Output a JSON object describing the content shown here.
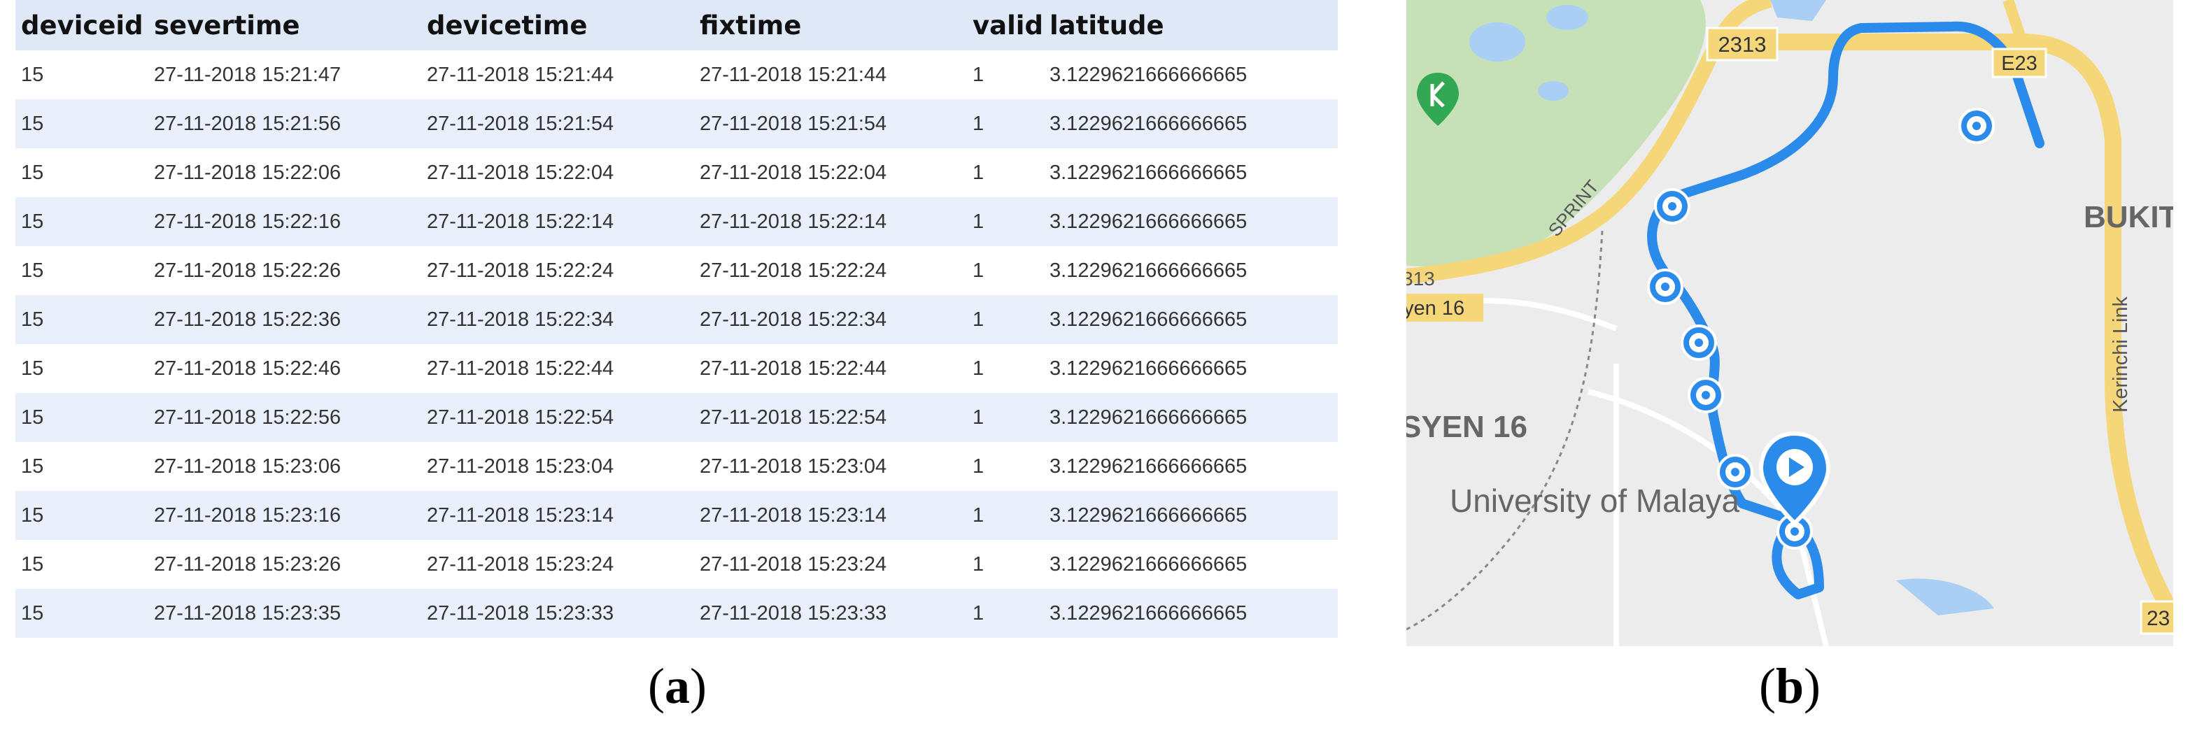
{
  "table": {
    "columns": [
      "deviceid",
      "severtime",
      "devicetime",
      "fixtime",
      "valid",
      "latitude"
    ],
    "rows": [
      [
        "15",
        "27-11-2018 15:21:47",
        "27-11-2018 15:21:44",
        "27-11-2018 15:21:44",
        "1",
        "3.1229621666666665"
      ],
      [
        "15",
        "27-11-2018 15:21:56",
        "27-11-2018 15:21:54",
        "27-11-2018 15:21:54",
        "1",
        "3.1229621666666665"
      ],
      [
        "15",
        "27-11-2018 15:22:06",
        "27-11-2018 15:22:04",
        "27-11-2018 15:22:04",
        "1",
        "3.1229621666666665"
      ],
      [
        "15",
        "27-11-2018 15:22:16",
        "27-11-2018 15:22:14",
        "27-11-2018 15:22:14",
        "1",
        "3.1229621666666665"
      ],
      [
        "15",
        "27-11-2018 15:22:26",
        "27-11-2018 15:22:24",
        "27-11-2018 15:22:24",
        "1",
        "3.1229621666666665"
      ],
      [
        "15",
        "27-11-2018 15:22:36",
        "27-11-2018 15:22:34",
        "27-11-2018 15:22:34",
        "1",
        "3.1229621666666665"
      ],
      [
        "15",
        "27-11-2018 15:22:46",
        "27-11-2018 15:22:44",
        "27-11-2018 15:22:44",
        "1",
        "3.1229621666666665"
      ],
      [
        "15",
        "27-11-2018 15:22:56",
        "27-11-2018 15:22:54",
        "27-11-2018 15:22:54",
        "1",
        "3.1229621666666665"
      ],
      [
        "15",
        "27-11-2018 15:23:06",
        "27-11-2018 15:23:04",
        "27-11-2018 15:23:04",
        "1",
        "3.1229621666666665"
      ],
      [
        "15",
        "27-11-2018 15:23:16",
        "27-11-2018 15:23:14",
        "27-11-2018 15:23:14",
        "1",
        "3.1229621666666665"
      ],
      [
        "15",
        "27-11-2018 15:23:26",
        "27-11-2018 15:23:24",
        "27-11-2018 15:23:24",
        "1",
        "3.1229621666666665"
      ],
      [
        "15",
        "27-11-2018 15:23:35",
        "27-11-2018 15:23:33",
        "27-11-2018 15:23:33",
        "1",
        "3.1229621666666665"
      ]
    ]
  },
  "map": {
    "labels": {
      "road_2313_top": "2313",
      "road_e23": "E23",
      "road_sprint": "SPRINT",
      "road_313_left": "313",
      "area_syen16_small": "yen 16",
      "area_bukit": "BUKIT",
      "road_kerinchi": "Kerinchi Link",
      "area_syen16": "SYEN 16",
      "place_university": "University of Malaya",
      "road_23_bottom": "23"
    },
    "icons": {
      "park_marker": "park-marker-icon",
      "play_marker": "play-marker-icon",
      "waypoint": "waypoint-icon"
    },
    "colors": {
      "route": "#2a8bea",
      "park": "#c6e0b8",
      "water": "#a9cff5",
      "highway": "#f5d77a",
      "land": "#ececec",
      "park_pin": "#33a852"
    }
  },
  "captions": {
    "a_open": "(",
    "a_letter": "a",
    "a_close": ")",
    "b_open": "(",
    "b_letter": "b",
    "b_close": ")"
  }
}
